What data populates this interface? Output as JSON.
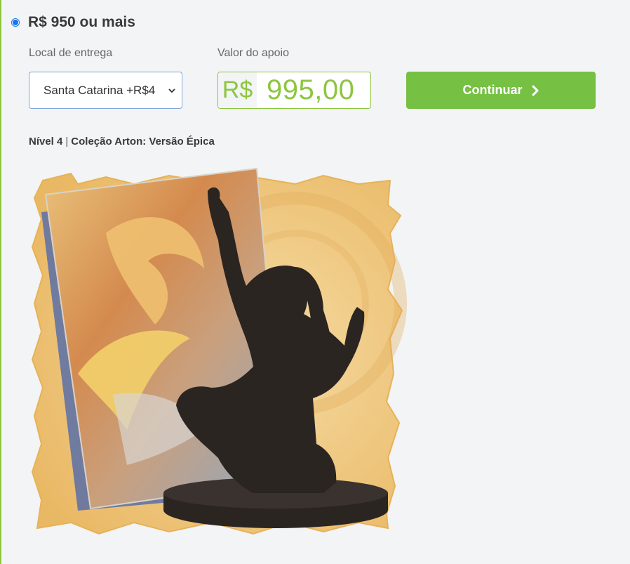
{
  "reward": {
    "title": "R$ 950 ou mais",
    "selected": true
  },
  "delivery": {
    "label": "Local de entrega",
    "selected_option": "Santa Catarina +R$4"
  },
  "support": {
    "label": "Valor do apoio",
    "currency": "R$",
    "amount": "995,00"
  },
  "actions": {
    "continue_label": "Continuar"
  },
  "tier": {
    "level": "Nível 4",
    "separator": "|",
    "name": "Coleção Arton: Versão Épica"
  },
  "colors": {
    "accent_green": "#76c043",
    "radio_blue": "#1a73e8"
  },
  "icons": [
    "radio-selected-icon",
    "chevron-down-icon",
    "chevron-right-icon"
  ]
}
